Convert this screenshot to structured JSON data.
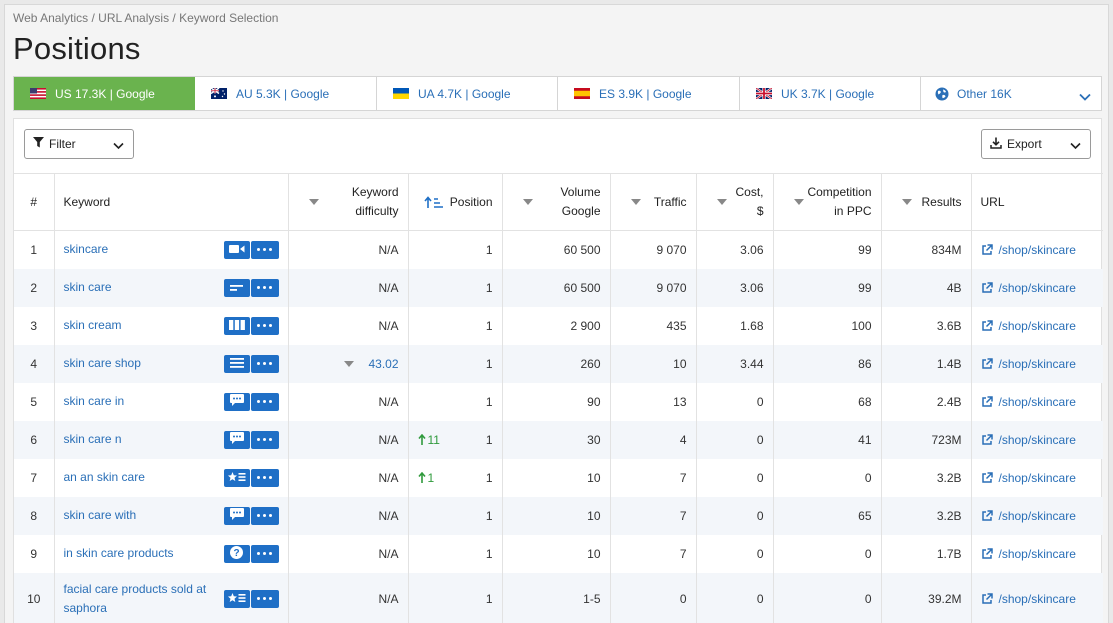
{
  "breadcrumb": "Web Analytics / URL Analysis / Keyword Selection",
  "page_title": "Positions",
  "tabs": [
    {
      "label": "US 17.3K | Google",
      "flag": "us",
      "active": true
    },
    {
      "label": "AU 5.3K | Google",
      "flag": "au",
      "active": false
    },
    {
      "label": "UA 4.7K | Google",
      "flag": "ua",
      "active": false
    },
    {
      "label": "ES 3.9K | Google",
      "flag": "es",
      "active": false
    },
    {
      "label": "UK 3.7K | Google",
      "flag": "uk",
      "active": false
    },
    {
      "label": "Other 16K",
      "flag": "globe-icon",
      "active": false
    }
  ],
  "toolbar": {
    "filter_label": "Filter",
    "export_label": "Export"
  },
  "columns": {
    "index": "#",
    "keyword": "Keyword",
    "difficulty_1": "Keyword",
    "difficulty_2": "difficulty",
    "position": "Position",
    "volume_1": "Volume",
    "volume_2": "Google",
    "traffic": "Traffic",
    "cost_1": "Cost,",
    "cost_2": "$",
    "competition_1": "Competition",
    "competition_2": "in PPC",
    "results": "Results",
    "url": "URL"
  },
  "rows": [
    {
      "n": "1",
      "keyword": "skincare",
      "feature": "video-icon",
      "difficulty": "N/A",
      "change": "",
      "position": "1",
      "volume": "60 500",
      "traffic": "9 070",
      "cost": "3.06",
      "competition": "99",
      "results": "834M",
      "url": "/shop/skincare"
    },
    {
      "n": "2",
      "keyword": "skin care",
      "feature": "snippet-icon",
      "difficulty": "N/A",
      "change": "",
      "position": "1",
      "volume": "60 500",
      "traffic": "9 070",
      "cost": "3.06",
      "competition": "99",
      "results": "4B",
      "url": "/shop/skincare"
    },
    {
      "n": "3",
      "keyword": "skin cream",
      "feature": "carousel-icon",
      "difficulty": "N/A",
      "change": "",
      "position": "1",
      "volume": "2 900",
      "traffic": "435",
      "cost": "1.68",
      "competition": "100",
      "results": "3.6B",
      "url": "/shop/skincare"
    },
    {
      "n": "4",
      "keyword": "skin care shop",
      "feature": "list-icon",
      "difficulty": "43.02",
      "change": "",
      "position": "1",
      "volume": "260",
      "traffic": "10",
      "cost": "3.44",
      "competition": "86",
      "results": "1.4B",
      "url": "/shop/skincare"
    },
    {
      "n": "5",
      "keyword": "skin care in",
      "feature": "comment-icon",
      "difficulty": "N/A",
      "change": "",
      "position": "1",
      "volume": "90",
      "traffic": "13",
      "cost": "0",
      "competition": "68",
      "results": "2.4B",
      "url": "/shop/skincare"
    },
    {
      "n": "6",
      "keyword": "skin care n",
      "feature": "comment-icon",
      "difficulty": "N/A",
      "change": "11",
      "position": "1",
      "volume": "30",
      "traffic": "4",
      "cost": "0",
      "competition": "41",
      "results": "723M",
      "url": "/shop/skincare"
    },
    {
      "n": "7",
      "keyword": "an an skin care",
      "feature": "review-icon",
      "difficulty": "N/A",
      "change": "1",
      "position": "1",
      "volume": "10",
      "traffic": "7",
      "cost": "0",
      "competition": "0",
      "results": "3.2B",
      "url": "/shop/skincare"
    },
    {
      "n": "8",
      "keyword": "skin care with",
      "feature": "comment-icon",
      "difficulty": "N/A",
      "change": "",
      "position": "1",
      "volume": "10",
      "traffic": "7",
      "cost": "0",
      "competition": "65",
      "results": "3.2B",
      "url": "/shop/skincare"
    },
    {
      "n": "9",
      "keyword": "in skin care products",
      "feature": "question-icon",
      "difficulty": "N/A",
      "change": "",
      "position": "1",
      "volume": "10",
      "traffic": "7",
      "cost": "0",
      "competition": "0",
      "results": "1.7B",
      "url": "/shop/skincare"
    },
    {
      "n": "10",
      "keyword": "facial care products sold at saphora",
      "feature": "review-icon",
      "difficulty": "N/A",
      "change": "",
      "position": "1",
      "volume": "1-5",
      "traffic": "0",
      "cost": "0",
      "competition": "0",
      "results": "39.2M",
      "url": "/shop/skincare"
    }
  ],
  "colors": {
    "accent": "#6ab34e",
    "link": "#2a6fb7",
    "feature": "#1f6fc6",
    "up": "#2f9a3c"
  }
}
